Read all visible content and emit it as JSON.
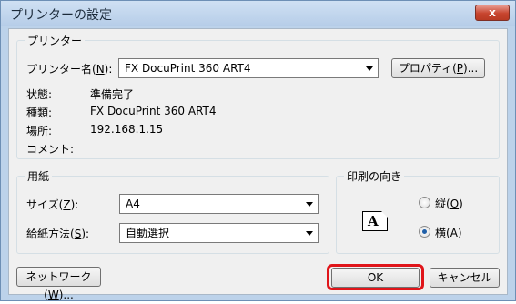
{
  "window": {
    "title": "プリンターの設定",
    "close_label": "x"
  },
  "printer_group": {
    "title": "プリンター",
    "name_label": "プリンター名(",
    "name_key": "N",
    "name_suffix": "):",
    "name_value": "FX DocuPrint 360 ART4",
    "properties_label_pre": "プロパティ(",
    "properties_key": "P",
    "properties_label_post": ")...",
    "status_label": "状態:",
    "status_value": "準備完了",
    "type_label": "種類:",
    "type_value": "FX DocuPrint 360 ART4",
    "location_label": "場所:",
    "location_value": "192.168.1.15",
    "comment_label": "コメント:"
  },
  "paper_group": {
    "title": "用紙",
    "size_label_pre": "サイズ(",
    "size_key": "Z",
    "size_label_post": "):",
    "size_value": "A4",
    "source_label_pre": "給紙方法(",
    "source_key": "S",
    "source_label_post": "):",
    "source_value": "自動選択"
  },
  "orientation_group": {
    "title": "印刷の向き",
    "icon_letter": "A",
    "portrait_label_pre": "縦(",
    "portrait_key": "O",
    "portrait_label_post": ")",
    "landscape_label_pre": "横(",
    "landscape_key": "A",
    "landscape_label_post": ")",
    "selected": "landscape"
  },
  "footer": {
    "network_pre": "ネットワーク(",
    "network_key": "W",
    "network_post": ")...",
    "ok_label": "OK",
    "cancel_label": "キャンセル"
  },
  "colors": {
    "highlight": "#e0151a",
    "close_button": "#c8452f",
    "radio_selected": "#1f5fa8"
  }
}
